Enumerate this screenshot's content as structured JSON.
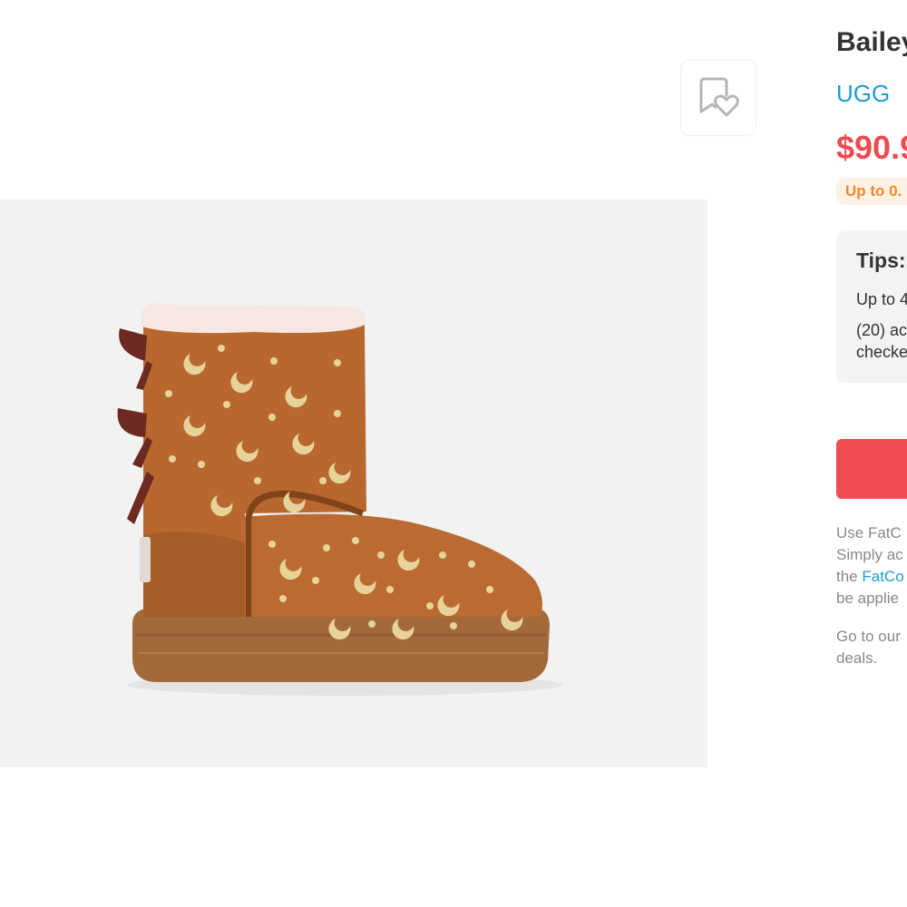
{
  "product": {
    "title": "Bailey",
    "brand": "UGG",
    "price": "$90.9",
    "image_alt": "UGG kids boot in chestnut suede with gold moons and stars and back bows"
  },
  "cashback": {
    "badge": "Up to 0."
  },
  "tips": {
    "title": "Tips:",
    "line1": "Up to 4",
    "line2": "(20) ac",
    "line3": "checke"
  },
  "info": {
    "line1": "Use FatC",
    "line2": "Simply ac",
    "line3_prefix": "the ",
    "line3_link": "FatCo",
    "line4": "be applie",
    "line5": "Go to our",
    "line6": "deals."
  },
  "icons": {
    "wishlist": "bookmark-heart-icon"
  },
  "colors": {
    "accent_red": "#ef4a4e",
    "cta_red": "#f14c52",
    "link_blue": "#1e9bd7",
    "cashback_orange": "#f58a23",
    "tips_bg": "#f2f3f5"
  }
}
